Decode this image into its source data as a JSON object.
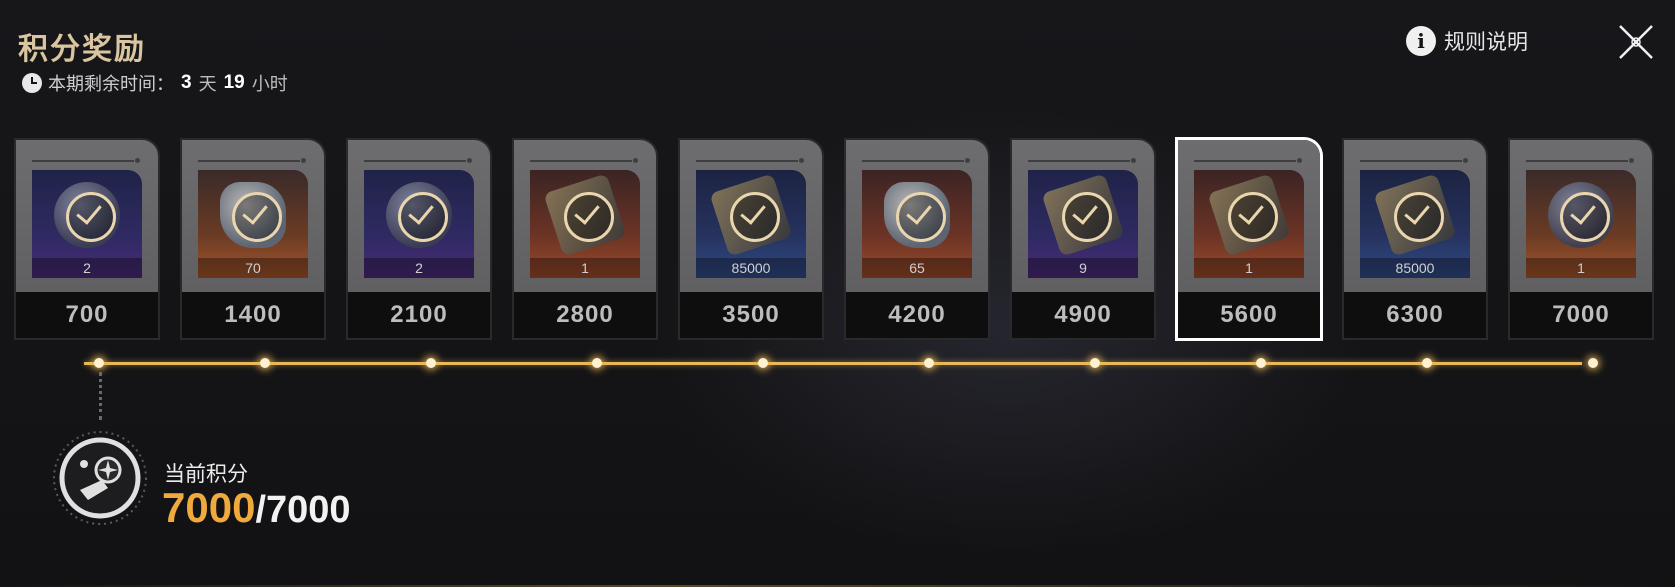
{
  "header": {
    "title": "积分奖励",
    "timer_label": "本期剩余时间：",
    "days": "3",
    "days_unit": "天",
    "hours": "19",
    "hours_unit": "小时",
    "rules_label": "规则说明"
  },
  "rewards": [
    {
      "points": "700",
      "count": "2",
      "art": "purple",
      "item": "medal",
      "claimed": true
    },
    {
      "points": "1400",
      "count": "70",
      "art": "orange",
      "item": "rock",
      "claimed": true
    },
    {
      "points": "2100",
      "count": "2",
      "art": "purple",
      "item": "medal",
      "claimed": true
    },
    {
      "points": "2800",
      "count": "1",
      "art": "red",
      "item": "box",
      "claimed": true
    },
    {
      "points": "3500",
      "count": "85000",
      "art": "blue",
      "item": "box",
      "claimed": true
    },
    {
      "points": "4200",
      "count": "65",
      "art": "red",
      "item": "rock",
      "claimed": true
    },
    {
      "points": "4900",
      "count": "9",
      "art": "purple",
      "item": "box",
      "claimed": true
    },
    {
      "points": "5600",
      "count": "1",
      "art": "red",
      "item": "box",
      "claimed": true,
      "selected": true
    },
    {
      "points": "6300",
      "count": "85000",
      "art": "blue",
      "item": "box",
      "claimed": true
    },
    {
      "points": "7000",
      "count": "1",
      "art": "orange",
      "item": "medal",
      "claimed": true
    }
  ],
  "current": {
    "label": "当前积分",
    "value": "7000",
    "separator": "/",
    "max": "7000"
  },
  "colors": {
    "title": "#d9c5a0",
    "accent": "#f0a93c",
    "track": "#e8b85a",
    "check": "#ead6ae"
  }
}
